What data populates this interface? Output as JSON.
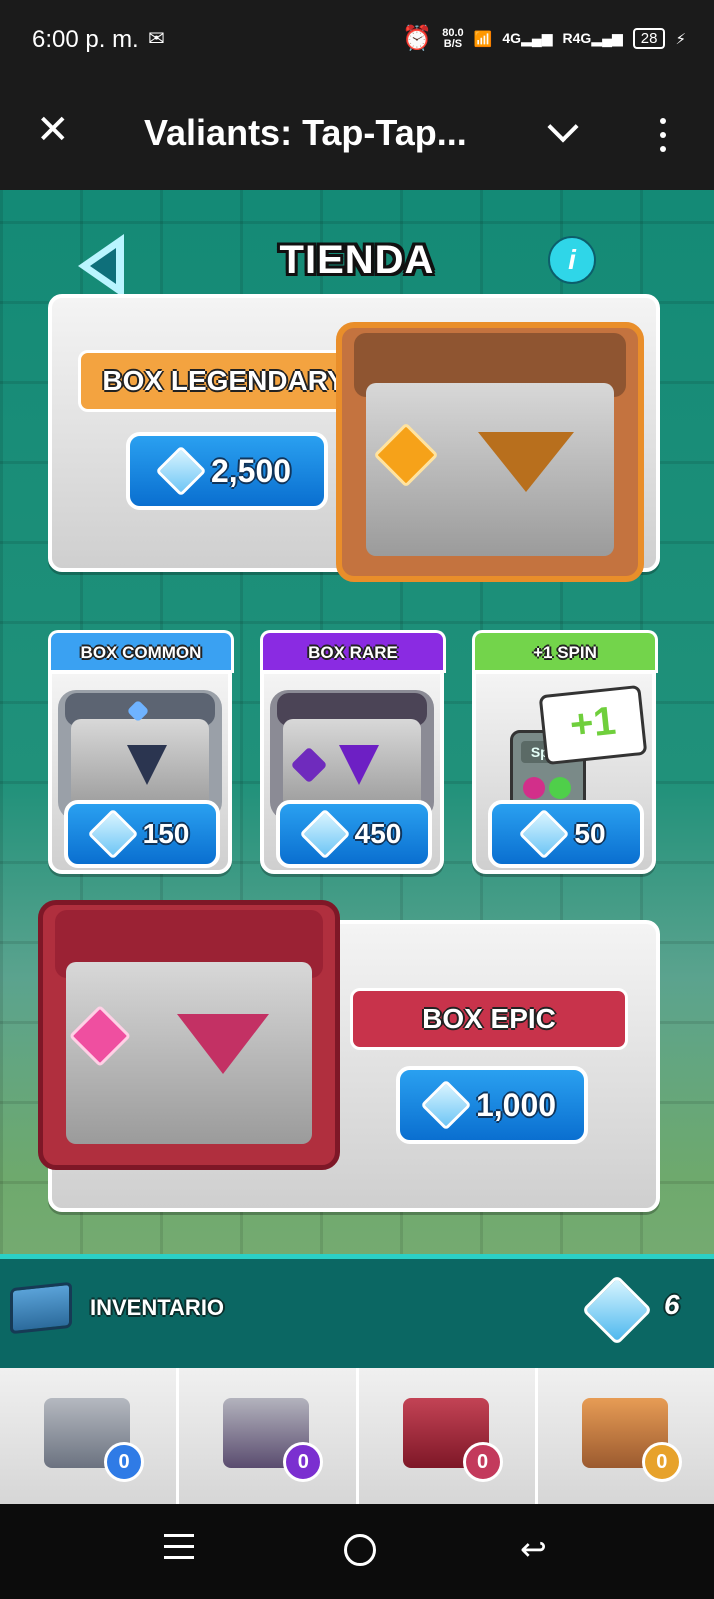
{
  "status_bar": {
    "time": "6:00 p. m.",
    "speed_value": "80.0",
    "speed_unit": "B/S",
    "net1": "4G",
    "net2": "R4G",
    "battery": "28"
  },
  "app_bar": {
    "title": "Valiants: Tap-Tap..."
  },
  "shop": {
    "title": "TIENDA",
    "legendary": {
      "label": "BOX LEGENDARY",
      "price": "2,500"
    },
    "common": {
      "label": "BOX COMMON",
      "price": "150"
    },
    "rare": {
      "label": "BOX RARE",
      "price": "450"
    },
    "spin": {
      "label": "+1 SPIN",
      "price": "50"
    },
    "epic": {
      "label": "BOX EPIC",
      "price": "1,000"
    }
  },
  "inventory": {
    "title": "INVENTARIO",
    "gems": "6",
    "slots": [
      {
        "type": "common",
        "count": "0"
      },
      {
        "type": "rare",
        "count": "0"
      },
      {
        "type": "epic",
        "count": "0"
      },
      {
        "type": "legendary",
        "count": "0"
      }
    ]
  },
  "colors": {
    "accent": "#2aa0f0",
    "legendary": "#f3a340",
    "common": "#3aa1f2",
    "rare": "#8a2be2",
    "spin": "#73d44b",
    "epic": "#c8334b"
  }
}
